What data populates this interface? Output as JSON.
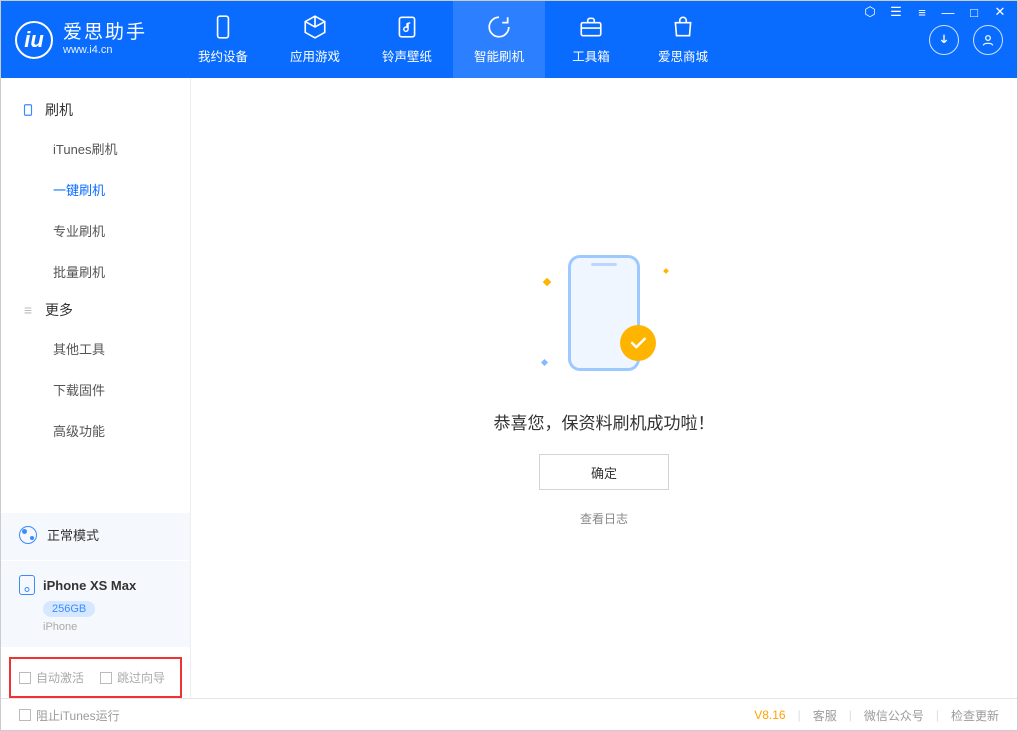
{
  "app": {
    "title": "爱思助手",
    "subtitle": "www.i4.cn"
  },
  "nav": {
    "tabs": [
      {
        "id": "device",
        "label": "我约设备"
      },
      {
        "id": "apps",
        "label": "应用游戏"
      },
      {
        "id": "ringtones",
        "label": "铃声壁纸"
      },
      {
        "id": "flash",
        "label": "智能刷机"
      },
      {
        "id": "toolbox",
        "label": "工具箱"
      },
      {
        "id": "store",
        "label": "爱思商城"
      }
    ]
  },
  "sidebar": {
    "flash": {
      "title": "刷机",
      "items": [
        "iTunes刷机",
        "一键刷机",
        "专业刷机",
        "批量刷机"
      ]
    },
    "more": {
      "title": "更多",
      "items": [
        "其他工具",
        "下载固件",
        "高级功能"
      ]
    },
    "mode_label": "正常模式",
    "device": {
      "name": "iPhone XS Max",
      "capacity": "256GB",
      "type": "iPhone"
    },
    "opts": {
      "auto_activate": "自动激活",
      "skip_guide": "跳过向导"
    }
  },
  "main": {
    "success_text": "恭喜您，保资料刷机成功啦！",
    "confirm": "确定",
    "view_log": "查看日志"
  },
  "footer": {
    "block_itunes": "阻止iTunes运行",
    "version": "V8.16",
    "links": [
      "客服",
      "微信公众号",
      "检查更新"
    ]
  }
}
